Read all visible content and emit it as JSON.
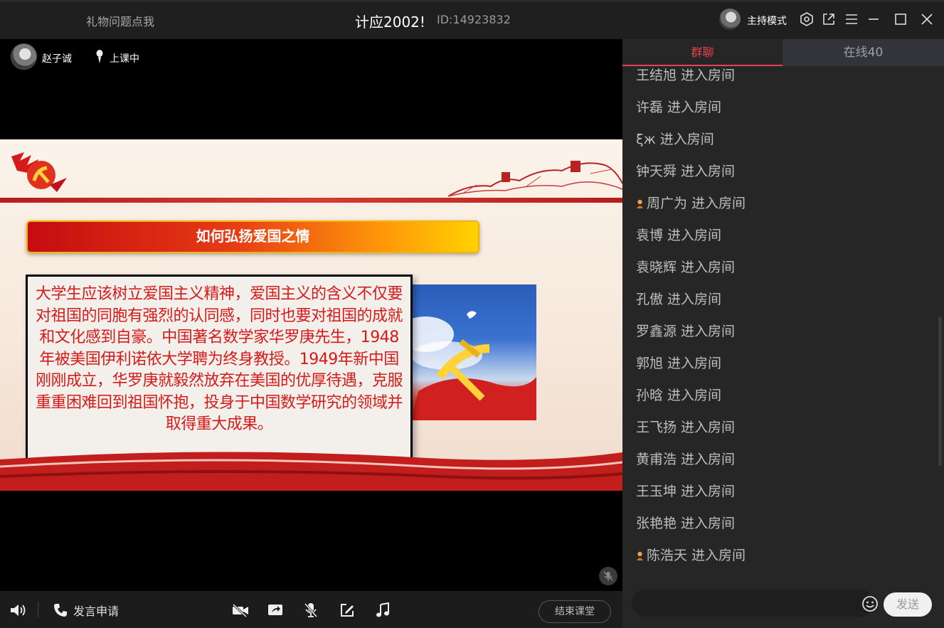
{
  "titlebar": {
    "gift_link": "礼物问题点我",
    "room_title": "计应2002!",
    "room_id": "ID:14923832",
    "host_mode": "主持模式"
  },
  "video": {
    "teacher_name": "赵子诚",
    "status": "上课中"
  },
  "slide": {
    "title": "如何弘扬爱国之情",
    "body": "大学生应该树立爱国主义精神，爱国主义的含义不仅要对祖国的同胞有强烈的认同感，同时也要对祖国的成就和文化感到自豪。中国著名数学家华罗庚先生，1948年被美国伊利诺依大学聘为终身教授。1949年新中国刚刚成立，华罗庚就毅然放弃在美国的优厚待遇，克服重重困难回到祖国怀抱，投身于中国数学研究的领域并取得重大成果。"
  },
  "toolbar": {
    "speak_request": "发言申请",
    "end_class": "结束课堂"
  },
  "side": {
    "tab_chat": "群聊",
    "tab_online": "在线40",
    "messages": [
      {
        "text": "王结旭 进入房间",
        "badge": false
      },
      {
        "text": "许磊 进入房间",
        "badge": false
      },
      {
        "text": "ξж 进入房间",
        "badge": false
      },
      {
        "text": "钟天舜 进入房间",
        "badge": false
      },
      {
        "text": "周广为 进入房间",
        "badge": true
      },
      {
        "text": "袁博 进入房间",
        "badge": false
      },
      {
        "text": "袁晓辉 进入房间",
        "badge": false
      },
      {
        "text": "孔傲 进入房间",
        "badge": false
      },
      {
        "text": "罗鑫源 进入房间",
        "badge": false
      },
      {
        "text": "郭旭 进入房间",
        "badge": false
      },
      {
        "text": "孙晗 进入房间",
        "badge": false
      },
      {
        "text": "王飞扬 进入房间",
        "badge": false
      },
      {
        "text": "黄甫浩 进入房间",
        "badge": false
      },
      {
        "text": "王玉坤 进入房间",
        "badge": false
      },
      {
        "text": "张艳艳 进入房间",
        "badge": false
      },
      {
        "text": "陈浩天 进入房间",
        "badge": true
      }
    ],
    "input_placeholder": "",
    "send_label": "发送"
  },
  "colors": {
    "accent": "#e8414e",
    "slide_text": "#d61a1a",
    "panel_bg": "#262626"
  }
}
